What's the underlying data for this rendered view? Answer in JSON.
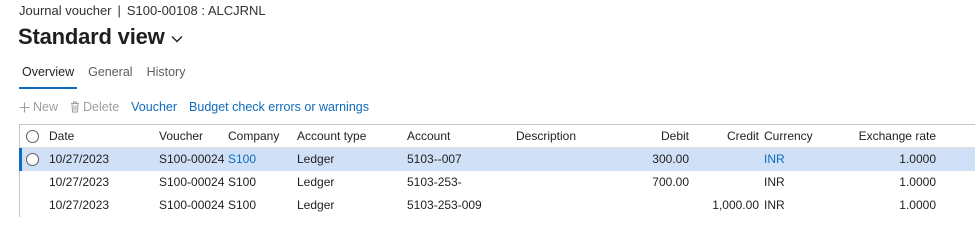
{
  "breadcrumb": {
    "module": "Journal voucher",
    "separator": "|",
    "record": "S100-00108 : ALCJRNL"
  },
  "view": {
    "title": "Standard view",
    "chevron_icon": "chevron-down-icon"
  },
  "tabs": [
    {
      "label": "Overview",
      "active": true
    },
    {
      "label": "General",
      "active": false
    },
    {
      "label": "History",
      "active": false
    }
  ],
  "toolbar": {
    "new_label": "New",
    "new_icon": "plus-icon",
    "delete_label": "Delete",
    "delete_icon": "trash-icon",
    "voucher_label": "Voucher",
    "budget_label": "Budget check errors or warnings"
  },
  "grid": {
    "columns": [
      "Date",
      "Voucher",
      "Company",
      "Account type",
      "Account",
      "Description",
      "Debit",
      "Credit",
      "Currency",
      "Exchange rate"
    ],
    "rows": [
      {
        "date": "10/27/2023",
        "voucher": "S100-00024",
        "company": "S100",
        "account_type": "Ledger",
        "account": "5103--007",
        "description": "",
        "debit": "300.00",
        "credit": "",
        "currency": "INR",
        "exchange_rate": "1.0000",
        "selected": true
      },
      {
        "date": "10/27/2023",
        "voucher": "S100-00024",
        "company": "S100",
        "account_type": "Ledger",
        "account": "5103-253-",
        "description": "",
        "debit": "700.00",
        "credit": "",
        "currency": "INR",
        "exchange_rate": "1.0000",
        "selected": false
      },
      {
        "date": "10/27/2023",
        "voucher": "S100-00024",
        "company": "S100",
        "account_type": "Ledger",
        "account": "5103-253-009",
        "description": "",
        "debit": "",
        "credit": "1,000.00",
        "currency": "INR",
        "exchange_rate": "1.0000",
        "selected": false
      }
    ]
  },
  "colors": {
    "accent": "#0f6cbd",
    "selected_row": "#cfe0f7",
    "disabled_text": "#a19f9d"
  }
}
